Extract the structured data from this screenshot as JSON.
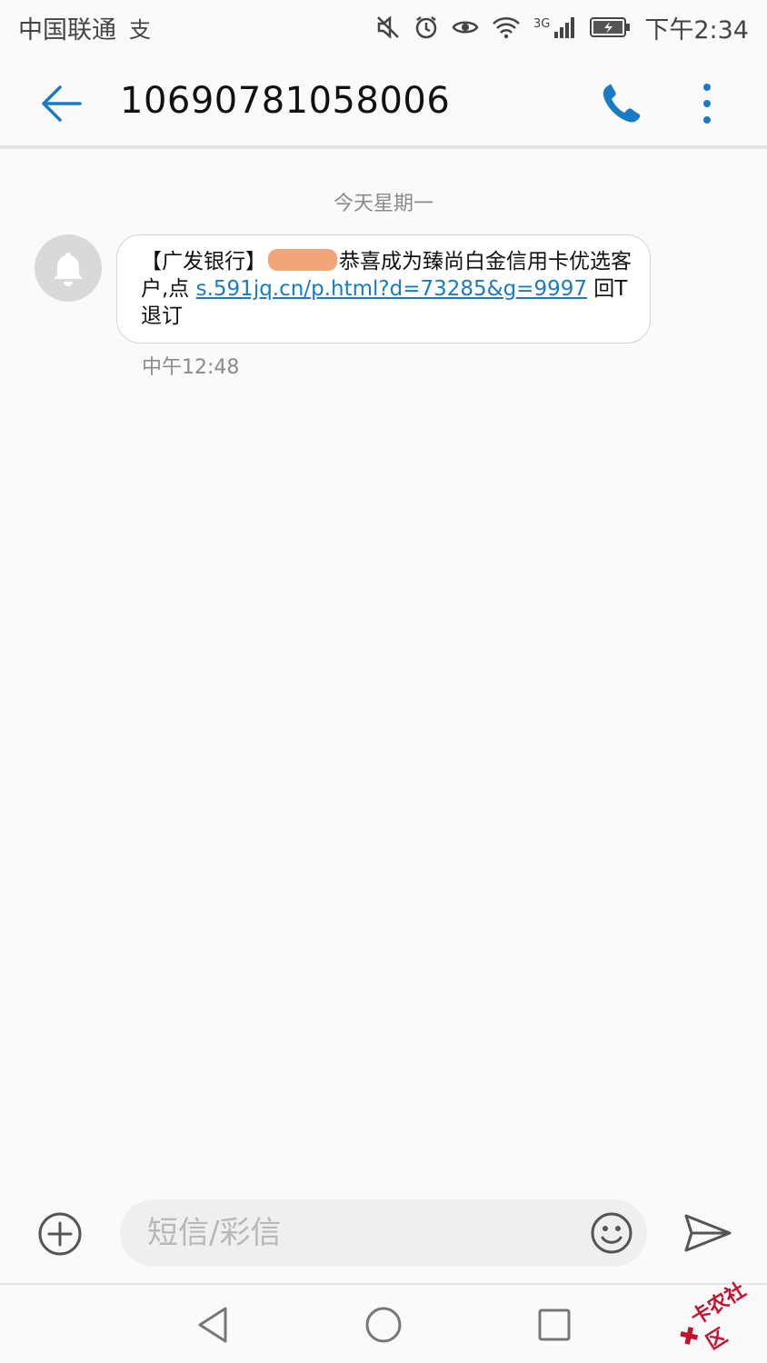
{
  "status_bar": {
    "carrier": "中国联通",
    "carrier_badge": "支",
    "network": "3G",
    "time": "下午2:34"
  },
  "app_bar": {
    "title": "10690781058006",
    "icons": [
      "back-arrow-icon",
      "phone-icon",
      "more-vert-icon"
    ],
    "accent_color": "#1a7bc5"
  },
  "conversation": {
    "date_separator": "今天星期一",
    "messages": [
      {
        "sender_icon": "bell-icon",
        "text_before_redaction": "【广发银行】",
        "text_after_redaction": "恭喜成为臻尚白金信用卡优选客户,点 ",
        "link": "s.591jq.cn/p.html?d=73285&g=9997",
        "text_after_link": " 回T退订",
        "time": "中午12:48"
      }
    ]
  },
  "composer": {
    "placeholder": "短信/彩信",
    "value": "",
    "icons": [
      "add-circle-icon",
      "emoji-icon",
      "send-icon"
    ]
  },
  "nav_bar": {
    "icons": [
      "nav-back-icon",
      "nav-home-icon",
      "nav-recent-icon"
    ]
  },
  "watermark": {
    "text": "卡农社区"
  }
}
